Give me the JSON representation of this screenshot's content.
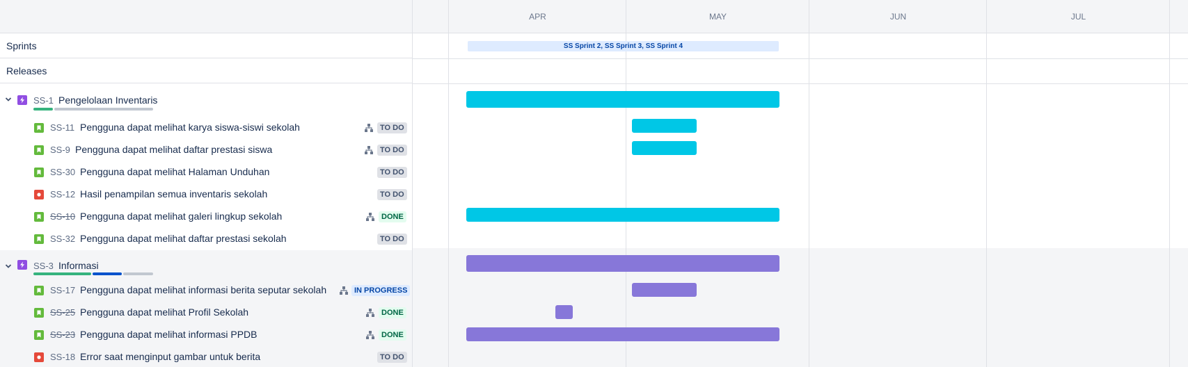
{
  "timeline": {
    "months": [
      "APR",
      "MAY",
      "JUN",
      "JUL"
    ],
    "sprints_label": "Sprints",
    "releases_label": "Releases",
    "sprint_bar_text": "SS Sprint 2, SS Sprint 3, SS Sprint 4"
  },
  "colors": {
    "epic_ss1": "#00c7e6",
    "epic_ss3": "#8777d9",
    "progress_done": "#36b37e",
    "progress_inprogress": "#0052cc",
    "progress_todo": "#c1c7d0"
  },
  "epics": [
    {
      "key": "SS-1",
      "summary": "Pengelolaan Inventaris",
      "type": "epic-icon",
      "progress": {
        "done": 0.2,
        "in_progress": 0.0,
        "todo": 0.8
      },
      "children": [
        {
          "key": "SS-11",
          "summary": "Pengguna dapat melihat karya siswa-siswi sekolah",
          "type": "story-icon",
          "has_child_issues": true,
          "status": "TO DO",
          "key_done": false
        },
        {
          "key": "SS-9",
          "summary": "Pengguna dapat melihat daftar prestasi siswa",
          "type": "story-icon",
          "has_child_issues": true,
          "status": "TO DO",
          "key_done": false
        },
        {
          "key": "SS-30",
          "summary": "Pengguna dapat melihat Halaman Unduhan",
          "type": "story-icon",
          "has_child_issues": false,
          "status": "TO DO",
          "key_done": false
        },
        {
          "key": "SS-12",
          "summary": "Hasil penampilan semua inventaris sekolah",
          "type": "bug-icon",
          "has_child_issues": false,
          "status": "TO DO",
          "key_done": false
        },
        {
          "key": "SS-10",
          "summary": "Pengguna dapat melihat galeri lingkup sekolah",
          "type": "story-icon",
          "has_child_issues": true,
          "status": "DONE",
          "key_done": true
        },
        {
          "key": "SS-32",
          "summary": "Pengguna dapat melihat daftar prestasi sekolah",
          "type": "story-icon",
          "has_child_issues": false,
          "status": "TO DO",
          "key_done": false
        }
      ]
    },
    {
      "key": "SS-3",
      "summary": "Informasi",
      "type": "epic-icon",
      "progress": {
        "done": 0.49,
        "in_progress": 0.25,
        "todo": 0.26
      },
      "children": [
        {
          "key": "SS-17",
          "summary": "Pengguna dapat melihat informasi berita seputar sekolah",
          "type": "story-icon",
          "has_child_issues": true,
          "status": "IN PROGRESS",
          "key_done": false
        },
        {
          "key": "SS-25",
          "summary": "Pengguna dapat melihat Profil Sekolah",
          "type": "story-icon",
          "has_child_issues": true,
          "status": "DONE",
          "key_done": true
        },
        {
          "key": "SS-23",
          "summary": "Pengguna dapat melihat informasi PPDB",
          "type": "story-icon",
          "has_child_issues": true,
          "status": "DONE",
          "key_done": true
        },
        {
          "key": "SS-18",
          "summary": "Error saat menginput gambar untuk berita",
          "type": "bug-icon",
          "has_child_issues": false,
          "status": "TO DO",
          "key_done": false
        }
      ]
    }
  ]
}
